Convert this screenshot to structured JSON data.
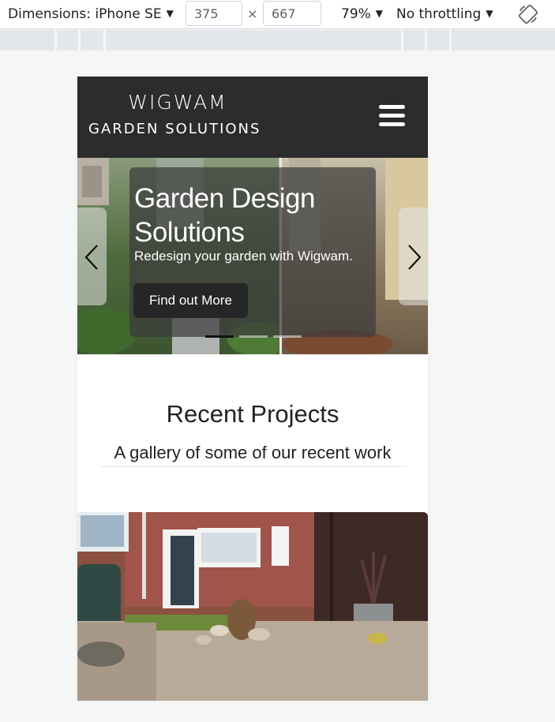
{
  "devtools": {
    "dimensions_label": "Dimensions: iPhone SE",
    "width": "375",
    "height": "667",
    "times": "×",
    "zoom": "79%",
    "throttling": "No throttling",
    "caret": "▼"
  },
  "site": {
    "brand_line1": "WIGWAM",
    "brand_line2": "GARDEN SOLUTIONS"
  },
  "hero": {
    "title": "Garden Design Solutions",
    "subtitle": "Redesign your garden with Wigwam.",
    "button_label": "Find out More",
    "slide_count": 3,
    "active_slide": 1
  },
  "recent_projects": {
    "title": "Recent Projects",
    "subtitle": "A gallery of some of our recent work"
  },
  "colors": {
    "navbar_bg": "#2c2c2c",
    "page_bg": "#f5f7f6"
  }
}
